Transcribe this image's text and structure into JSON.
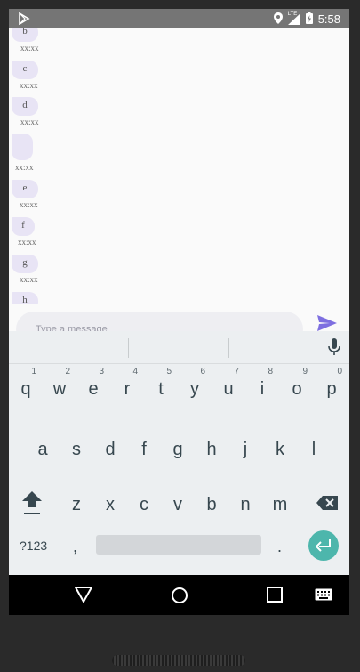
{
  "status_bar": {
    "time": "5:58",
    "network_label": "LTE",
    "icons": [
      "play-store-icon",
      "location-icon",
      "signal-icon",
      "battery-icon"
    ]
  },
  "chat": {
    "messages": [
      {
        "text": "b",
        "time": "xx:xx"
      },
      {
        "text": "c",
        "time": "xx:xx"
      },
      {
        "text": "d",
        "time": "xx:xx"
      },
      {
        "text": "",
        "time": "xx:xx"
      },
      {
        "text": "e",
        "time": "xx:xx"
      },
      {
        "text": "f",
        "time": "xx:xx"
      },
      {
        "text": "g",
        "time": "xx:xx"
      },
      {
        "text": "h",
        "time": ""
      }
    ]
  },
  "composer": {
    "placeholder": "Type a message",
    "send_icon": "send-icon"
  },
  "keyboard": {
    "row1": [
      {
        "key": "q",
        "num": "1"
      },
      {
        "key": "w",
        "num": "2"
      },
      {
        "key": "e",
        "num": "3"
      },
      {
        "key": "r",
        "num": "4"
      },
      {
        "key": "t",
        "num": "5"
      },
      {
        "key": "y",
        "num": "6"
      },
      {
        "key": "u",
        "num": "7"
      },
      {
        "key": "i",
        "num": "8"
      },
      {
        "key": "o",
        "num": "9"
      },
      {
        "key": "p",
        "num": "0"
      }
    ],
    "row2": [
      "a",
      "s",
      "d",
      "f",
      "g",
      "h",
      "j",
      "k",
      "l"
    ],
    "row3": [
      "z",
      "x",
      "c",
      "v",
      "b",
      "n",
      "m"
    ],
    "symbols_label": "?123",
    "comma_label": ",",
    "period_label": ".",
    "colors": {
      "background": "#eceff1",
      "enter": "#4db6ac",
      "key_text": "#37474f"
    }
  },
  "colors": {
    "bubble": "#e8e4f5",
    "send": "#7e6fe0",
    "status_bar": "#757575"
  }
}
